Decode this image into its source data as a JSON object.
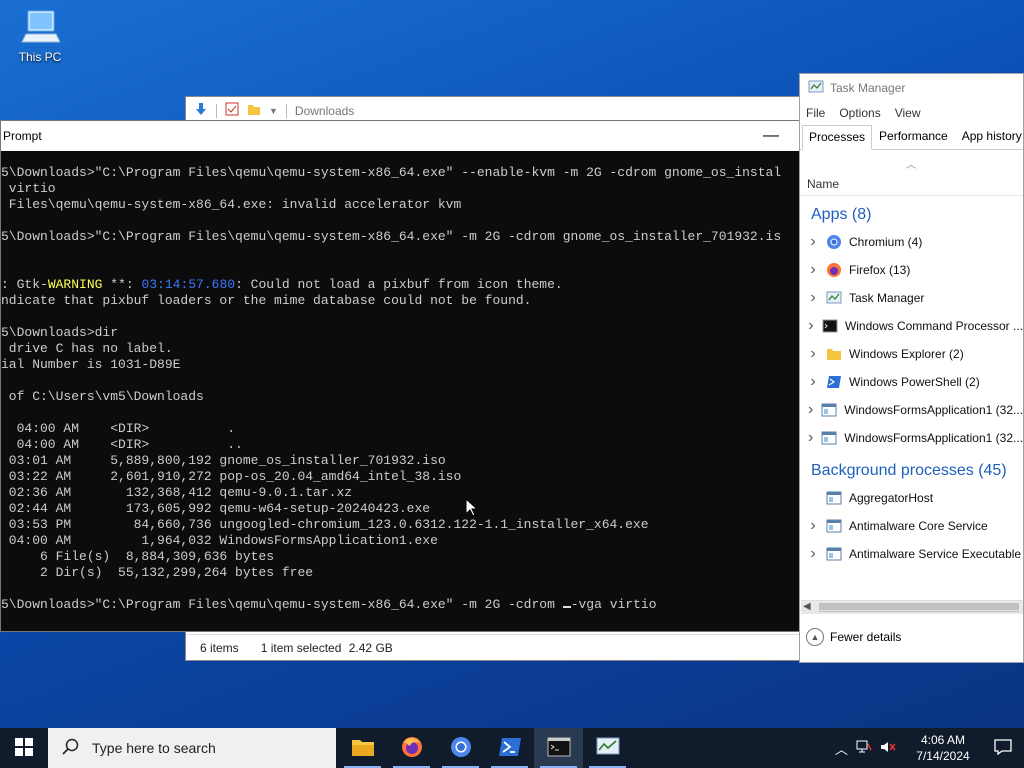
{
  "desktop": {
    "icons": [
      {
        "label": "This PC",
        "icon": "this-pc-icon"
      }
    ]
  },
  "explorer": {
    "title": "Downloads",
    "status": {
      "items": "6 items",
      "selected": "1 item selected",
      "size": "2.42 GB"
    }
  },
  "cmd": {
    "title": "Prompt",
    "lines": [
      "5\\Downloads>\"C:\\Program Files\\qemu\\qemu-system-x86_64.exe\" --enable-kvm -m 2G -cdrom gnome_os_instal",
      " virtio",
      " Files\\qemu\\qemu-system-x86_64.exe: invalid accelerator kvm",
      "",
      "5\\Downloads>\"C:\\Program Files\\qemu\\qemu-system-x86_64.exe\" -m 2G -cdrom gnome_os_installer_701932.is",
      "",
      "",
      "__WARN__",
      "ndicate that pixbuf loaders or the mime database could not be found.",
      "",
      "5\\Downloads>dir",
      " drive C has no label.",
      "ial Number is 1031-D89E",
      "",
      " of C:\\Users\\vm5\\Downloads",
      "",
      "  04:00 AM    <DIR>          .",
      "  04:00 AM    <DIR>          ..",
      " 03:01 AM     5,889,800,192 gnome_os_installer_701932.iso",
      " 03:22 AM     2,601,910,272 pop-os_20.04_amd64_intel_38.iso",
      " 02:36 AM       132,368,412 qemu-9.0.1.tar.xz",
      " 02:44 AM       173,605,992 qemu-w64-setup-20240423.exe",
      " 03:53 PM        84,660,736 ungoogled-chromium_123.0.6312.122-1.1_installer_x64.exe",
      " 04:00 AM         1,964,032 WindowsFormsApplication1.exe",
      "     6 File(s)  8,884,309,636 bytes",
      "     2 Dir(s)  55,132,299,264 bytes free",
      "",
      "__LAST__"
    ],
    "warning": {
      "prefix": ": Gtk-",
      "level": "WARNING",
      "mid": " **: ",
      "time": "03:14:57.680",
      "message": ": Could not load a pixbuf from icon theme."
    },
    "last_line": {
      "before": "5\\Downloads>\"C:\\Program Files\\qemu\\qemu-system-x86_64.exe\" -m 2G -cdrom ",
      "after": "-vga virtio"
    }
  },
  "taskmgr": {
    "title": "Task Manager",
    "menu": [
      "File",
      "Options",
      "View"
    ],
    "tabs": [
      "Processes",
      "Performance",
      "App history"
    ],
    "column": "Name",
    "apps_header": "Apps (8)",
    "apps": [
      {
        "name": "Chromium (4)",
        "icon": "chromium-icon",
        "expandable": true
      },
      {
        "name": "Firefox (13)",
        "icon": "firefox-icon",
        "expandable": true
      },
      {
        "name": "Task Manager",
        "icon": "task-manager-icon",
        "expandable": true
      },
      {
        "name": "Windows Command Processor ...",
        "icon": "cmd-icon",
        "expandable": true
      },
      {
        "name": "Windows Explorer (2)",
        "icon": "folder-icon",
        "expandable": true
      },
      {
        "name": "Windows PowerShell (2)",
        "icon": "powershell-icon",
        "expandable": true
      },
      {
        "name": "WindowsFormsApplication1 (32...",
        "icon": "app-window-icon",
        "expandable": true
      },
      {
        "name": "WindowsFormsApplication1 (32...",
        "icon": "app-window-icon",
        "expandable": true
      }
    ],
    "bg_header": "Background processes (45)",
    "background": [
      {
        "name": "AggregatorHost",
        "icon": "app-window-icon",
        "expandable": false
      },
      {
        "name": "Antimalware Core Service",
        "icon": "app-window-icon",
        "expandable": true
      },
      {
        "name": "Antimalware Service Executable",
        "icon": "app-window-icon",
        "expandable": true
      }
    ],
    "fewer_details": "Fewer details"
  },
  "taskbar": {
    "search_placeholder": "Type here to search",
    "apps": [
      {
        "name": "file-explorer",
        "icon": "folder-icon"
      },
      {
        "name": "firefox",
        "icon": "firefox-icon"
      },
      {
        "name": "chromium",
        "icon": "chromium-icon"
      },
      {
        "name": "powershell",
        "icon": "powershell-icon"
      },
      {
        "name": "command-prompt",
        "icon": "cmd-icon"
      },
      {
        "name": "task-manager",
        "icon": "task-manager-icon"
      }
    ],
    "time": "4:06 AM",
    "date": "7/14/2024"
  }
}
